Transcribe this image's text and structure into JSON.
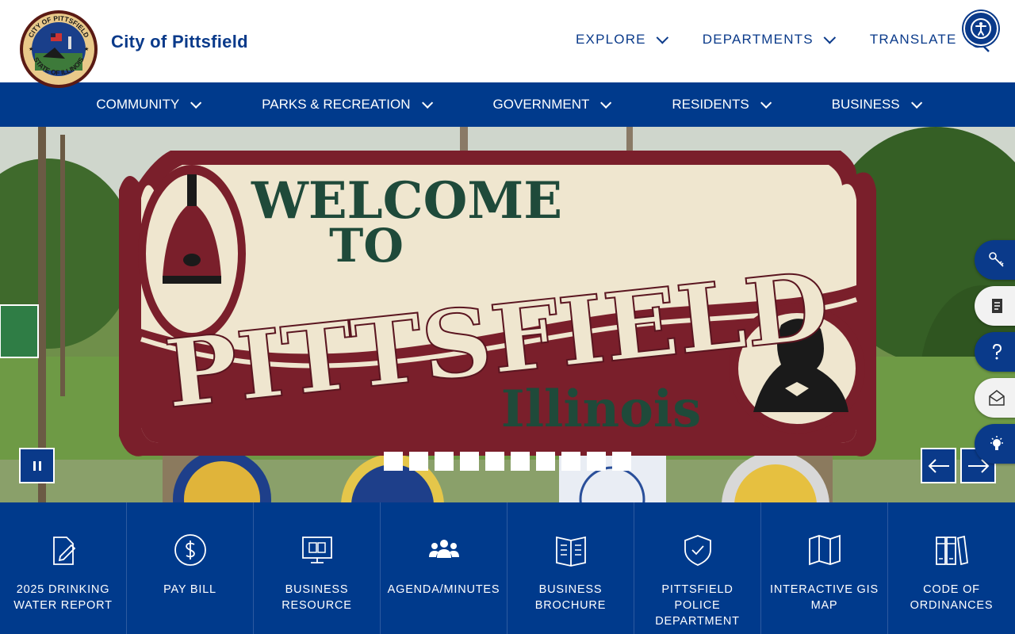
{
  "header": {
    "site_name": "City of Pittsfield",
    "seal_top_text": "CITY OF PITTSFIELD",
    "seal_bottom_text": "STATE OF ILLINOIS",
    "utility_nav": [
      {
        "label": "EXPLORE"
      },
      {
        "label": "DEPARTMENTS"
      },
      {
        "label": "TRANSLATE"
      }
    ]
  },
  "main_nav": [
    {
      "label": "COMMUNITY"
    },
    {
      "label": "PARKS & RECREATION"
    },
    {
      "label": "GOVERNMENT"
    },
    {
      "label": "RESIDENTS"
    },
    {
      "label": "BUSINESS"
    }
  ],
  "hero": {
    "sign_line1": "WELCOME",
    "sign_line2": "TO",
    "sign_line3": "PITTSFIELD",
    "sign_line4": "Illinois",
    "slide_count": 10
  },
  "quick_links": [
    {
      "label": "2025 DRINKING WATER REPORT",
      "icon": "edit-document-icon"
    },
    {
      "label": "PAY BILL",
      "icon": "dollar-circle-icon"
    },
    {
      "label": "BUSINESS RESOURCE",
      "icon": "monitor-book-icon"
    },
    {
      "label": "AGENDA/MINUTES",
      "icon": "group-people-icon"
    },
    {
      "label": "BUSINESS BROCHURE",
      "icon": "open-book-icon"
    },
    {
      "label": "PITTSFIELD POLICE DEPARTMENT",
      "icon": "shield-check-icon"
    },
    {
      "label": "INTERACTIVE GIS MAP",
      "icon": "folded-map-icon"
    },
    {
      "label": "CODE OF ORDINANCES",
      "icon": "binders-icon"
    }
  ],
  "colors": {
    "brand_blue": "#003a8c",
    "sign_maroon": "#7a1f2b",
    "sign_cream": "#efe6cf",
    "sign_green": "#1f4a3a"
  }
}
